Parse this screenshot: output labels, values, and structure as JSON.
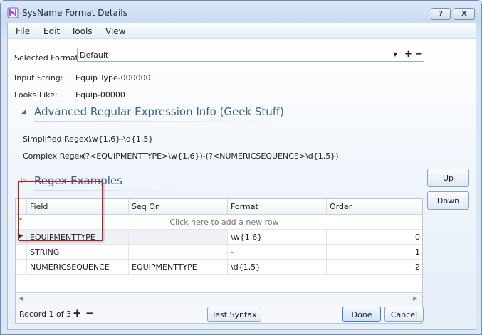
{
  "window": {
    "title": "SysName Format Details",
    "help_label": "?",
    "close_label": "X"
  },
  "menu": [
    "File",
    "Edit",
    "Tools",
    "View"
  ],
  "format": {
    "label": "Selected Format:",
    "value": "Default",
    "add_symbol": "+",
    "remove_symbol": "−"
  },
  "input_string": {
    "label": "Input String:",
    "value": "Equip Type-000000"
  },
  "looks_like": {
    "label": "Looks Like:",
    "value": "Equip-00000"
  },
  "advanced_section": {
    "title": "Advanced Regular Expression Info (Geek Stuff)",
    "simplified_label": "Simplified Regex:",
    "simplified_value": "\\w{1,6}-\\d{1,5}",
    "complex_label": "Complex Regex:",
    "complex_value": "(?<EQUIPMENTTYPE>\\w{1,6})-(?<NUMERICSEQUENCE>\\d{1,5})"
  },
  "examples_section": {
    "title": "Regex Examples"
  },
  "side_buttons": {
    "up": "Up",
    "down": "Down"
  },
  "grid": {
    "columns": [
      "Field",
      "Seq On",
      "Format",
      "Order"
    ],
    "new_row_marker": "*",
    "new_row_hint": "Click here to add a new row",
    "current_row_marker": "▶",
    "rows": [
      {
        "field": "EQUIPMENTTYPE",
        "seq_on": "",
        "format": "\\w{1,6}",
        "order": "0"
      },
      {
        "field": "STRING",
        "seq_on": "",
        "format": "-",
        "order": "1"
      },
      {
        "field": "NUMERICSEQUENCE",
        "seq_on": "EQUIPMENTTYPE",
        "format": "\\d{1,5}",
        "order": "2"
      }
    ],
    "navigator": {
      "text": "Record 1 of 3",
      "add": "+",
      "remove": "−"
    }
  },
  "buttons": {
    "test_syntax": "Test Syntax",
    "done": "Done",
    "cancel": "Cancel"
  },
  "colors": {
    "accent": "#3b5f8f",
    "highlight": "#b22222"
  }
}
